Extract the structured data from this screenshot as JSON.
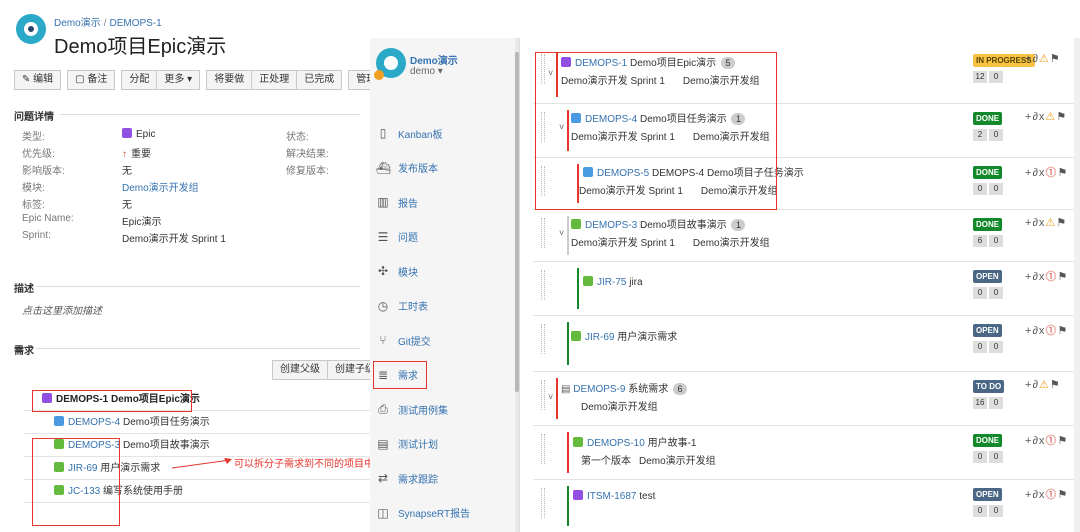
{
  "left": {
    "breadcrumb": {
      "project": "Demo演示",
      "separator": "/",
      "issue_key": "DEMOPS-1"
    },
    "title": "Demo项目Epic演示",
    "toolbar": {
      "edit": "✎ 编辑",
      "comment": "▢ 备注",
      "assign": "分配",
      "more": "更多 ▾",
      "todo": "将要做",
      "in_progress": "正处理",
      "done": "已完成",
      "manage": "管理 ▾"
    },
    "details_title": "问题详情",
    "details": [
      {
        "label": "类型:",
        "value": "Epic"
      },
      {
        "label": "优先级:",
        "value": "重要"
      },
      {
        "label": "影响版本:",
        "value": "无"
      },
      {
        "label": "模块:",
        "value": "Demo演示开发组"
      },
      {
        "label": "标签:",
        "value": "无"
      },
      {
        "label": "Epic Name:",
        "value": "Epic演示"
      },
      {
        "label": "Sprint:",
        "value": "Demo演示开发 Sprint 1"
      }
    ],
    "details_right": {
      "status": "状态:",
      "resolution": "解决结果:",
      "fix_version": "修复版本:"
    },
    "description_title": "描述",
    "description_placeholder": "点击这里添加描述",
    "requirements_title": "需求",
    "req_buttons": {
      "create_parent": "创建父级",
      "create_child": "创建子级"
    },
    "requirements": [
      {
        "key": "DEMOPS-1",
        "summary": "Demo项目Epic演示",
        "type": "epic"
      },
      {
        "key": "DEMOPS-4",
        "summary": "Demo项目任务演示",
        "type": "task"
      },
      {
        "key": "DEMOPS-3",
        "summary": "Demo项目故事演示",
        "type": "story"
      },
      {
        "key": "JIR-69",
        "summary": "用户演示需求",
        "type": "story"
      },
      {
        "key": "JC-133",
        "summary": "编写系统使用手册",
        "type": "story"
      }
    ],
    "annotation": "可以拆分子需求到不同的项目中"
  },
  "sidebar": {
    "project_name": "Demo演示",
    "project_sub": "demo ▾",
    "items": [
      {
        "label": "Kanban板",
        "icon": "board-icon"
      },
      {
        "label": "发布版本",
        "icon": "ship-icon"
      },
      {
        "label": "报告",
        "icon": "chart-icon"
      },
      {
        "label": "问题",
        "icon": "issues-icon"
      },
      {
        "label": "模块",
        "icon": "puzzle-icon"
      },
      {
        "label": "工时表",
        "icon": "clock-icon"
      },
      {
        "label": "Git提交",
        "icon": "git-icon"
      },
      {
        "label": "需求",
        "icon": "requirements-icon"
      },
      {
        "label": "测试用例集",
        "icon": "test-case-icon"
      },
      {
        "label": "测试计划",
        "icon": "test-plan-icon"
      },
      {
        "label": "需求跟踪",
        "icon": "shuffle-icon"
      },
      {
        "label": "SynapseRT报告",
        "icon": "report-icon"
      }
    ]
  },
  "right": {
    "rows": [
      {
        "key": "DEMOPS-1",
        "summary": "Demo项目Epic演示",
        "count": "5",
        "sprint": "Demo演示开发 Sprint 1",
        "component": "Demo演示开发组",
        "status": "IN PROGRESS",
        "nums": [
          "12",
          "0"
        ],
        "type": "epic"
      },
      {
        "key": "DEMOPS-4",
        "summary": "Demo项目任务演示",
        "count": "1",
        "sprint": "Demo演示开发 Sprint 1",
        "component": "Demo演示开发组",
        "status": "DONE",
        "nums": [
          "2",
          "0"
        ],
        "type": "task"
      },
      {
        "key": "DEMOPS-5",
        "summary": "DEMOPS-4 Demo项目子任务演示",
        "count": "",
        "sprint": "Demo演示开发 Sprint 1",
        "component": "Demo演示开发组",
        "status": "DONE",
        "nums": [
          "0",
          "0"
        ],
        "type": "task"
      },
      {
        "key": "DEMOPS-3",
        "summary": "Demo项目故事演示",
        "count": "1",
        "sprint": "Demo演示开发 Sprint 1",
        "component": "Demo演示开发组",
        "status": "DONE",
        "nums": [
          "6",
          "0"
        ],
        "type": "story"
      },
      {
        "key": "JIR-75",
        "summary": "jira",
        "count": "",
        "sprint": "",
        "component": "",
        "status": "OPEN",
        "nums": [
          "0",
          "0"
        ],
        "type": "story"
      },
      {
        "key": "JIR-69",
        "summary": "用户演示需求",
        "count": "",
        "sprint": "",
        "component": "",
        "status": "OPEN",
        "nums": [
          "0",
          "0"
        ],
        "type": "story"
      },
      {
        "key": "DEMOPS-9",
        "summary": "系统需求",
        "count": "6",
        "sprint": "",
        "component": "Demo演示开发组",
        "status": "TO DO",
        "nums": [
          "16",
          "0"
        ],
        "type": "doc"
      },
      {
        "key": "DEMOPS-10",
        "summary": "用户故事-1",
        "count": "",
        "sprint": "第一个版本",
        "component": "Demo演示开发组",
        "status": "DONE",
        "nums": [
          "0",
          "0"
        ],
        "type": "story"
      },
      {
        "key": "ITSM-1687",
        "summary": "test",
        "count": "",
        "sprint": "",
        "component": "",
        "status": "OPEN",
        "nums": [
          "0",
          "0"
        ],
        "type": "epic"
      }
    ],
    "action_glyphs": {
      "add": "+",
      "link": "∂",
      "remove": "x",
      "warn": "⚠",
      "error": "!",
      "flag": "⚑"
    }
  },
  "colors": {
    "epic": "#904ee2",
    "task": "#4a9ae1",
    "story": "#63ba3c",
    "accent": "#3572b0",
    "annotation": "#e5352d"
  }
}
